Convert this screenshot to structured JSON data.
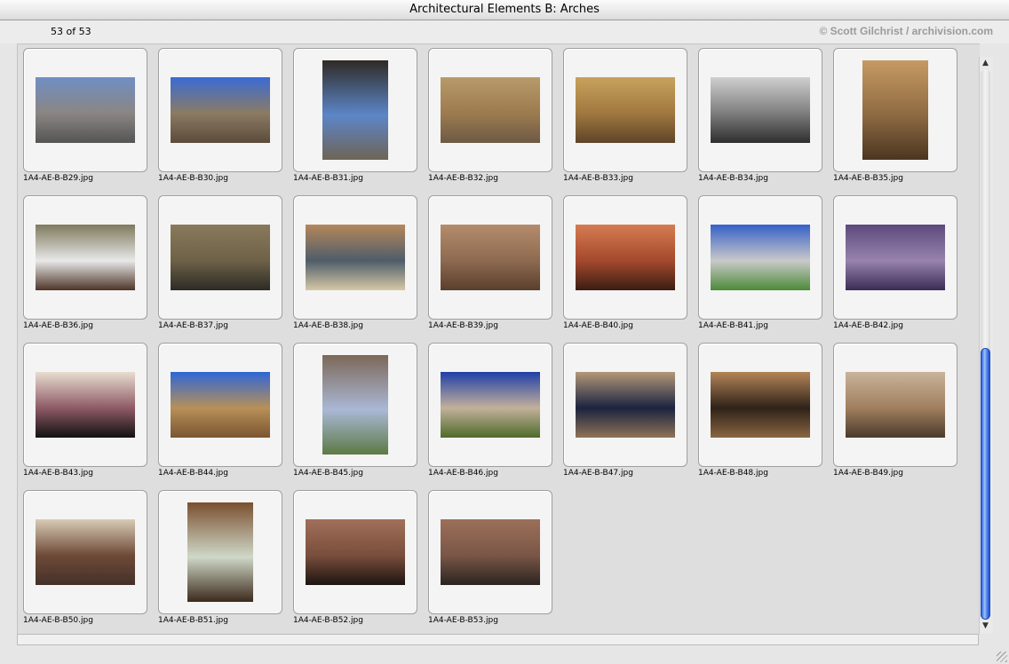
{
  "window": {
    "title": "Architectural Elements B: Arches"
  },
  "header": {
    "count": "53 of 53",
    "copyright": "© Scott Gilchrist / archivision.com"
  },
  "thumbnails": [
    {
      "file": "1A4-AE-B-B29.jpg",
      "orient": "land",
      "colors": [
        "#6f8fc4",
        "#8a8582",
        "#555"
      ]
    },
    {
      "file": "1A4-AE-B-B30.jpg",
      "orient": "land",
      "colors": [
        "#3a6bd4",
        "#8b7b63",
        "#5b4b3b"
      ]
    },
    {
      "file": "1A4-AE-B-B31.jpg",
      "orient": "port",
      "colors": [
        "#2f2a25",
        "#5c86c8",
        "#6e6456"
      ]
    },
    {
      "file": "1A4-AE-B-B32.jpg",
      "orient": "land",
      "colors": [
        "#b89a6a",
        "#9c7b4f",
        "#6d5a45"
      ]
    },
    {
      "file": "1A4-AE-B-B33.jpg",
      "orient": "land",
      "colors": [
        "#c7a25c",
        "#a07840",
        "#5e4428"
      ]
    },
    {
      "file": "1A4-AE-B-B34.jpg",
      "orient": "land",
      "colors": [
        "#cfcfcf",
        "#7d7d7d",
        "#2e2e2e"
      ]
    },
    {
      "file": "1A4-AE-B-B35.jpg",
      "orient": "port",
      "colors": [
        "#c69a63",
        "#8e6a42",
        "#4b3521"
      ]
    },
    {
      "file": "1A4-AE-B-B36.jpg",
      "orient": "land",
      "colors": [
        "#7f7a5e",
        "#e8e8e8",
        "#4e3528"
      ]
    },
    {
      "file": "1A4-AE-B-B37.jpg",
      "orient": "land",
      "colors": [
        "#8a7a5c",
        "#6d6148",
        "#2c2b25"
      ]
    },
    {
      "file": "1A4-AE-B-B38.jpg",
      "orient": "land",
      "colors": [
        "#b5875b",
        "#4e5d6a",
        "#d6c8a6"
      ]
    },
    {
      "file": "1A4-AE-B-B39.jpg",
      "orient": "land",
      "colors": [
        "#b48c6c",
        "#8d6a50",
        "#5a3e2d"
      ]
    },
    {
      "file": "1A4-AE-B-B40.jpg",
      "orient": "land",
      "colors": [
        "#d67c52",
        "#a4492d",
        "#3a1d12"
      ]
    },
    {
      "file": "1A4-AE-B-B41.jpg",
      "orient": "land",
      "colors": [
        "#3560c9",
        "#c9c9c9",
        "#4c8a38"
      ]
    },
    {
      "file": "1A4-AE-B-B42.jpg",
      "orient": "land",
      "colors": [
        "#5c4a7c",
        "#9883ad",
        "#3a2c55"
      ]
    },
    {
      "file": "1A4-AE-B-B43.jpg",
      "orient": "land",
      "colors": [
        "#e8ddd0",
        "#8e5a66",
        "#111"
      ]
    },
    {
      "file": "1A4-AE-B-B44.jpg",
      "orient": "land",
      "colors": [
        "#2e66d6",
        "#b89058",
        "#7a5530"
      ]
    },
    {
      "file": "1A4-AE-B-B45.jpg",
      "orient": "port",
      "colors": [
        "#7c6858",
        "#aab8d6",
        "#5c7a44"
      ]
    },
    {
      "file": "1A4-AE-B-B46.jpg",
      "orient": "land",
      "colors": [
        "#1f3fa8",
        "#c3b19a",
        "#4e6a2a"
      ]
    },
    {
      "file": "1A4-AE-B-B47.jpg",
      "orient": "land",
      "colors": [
        "#b49878",
        "#1b2340",
        "#8f7356"
      ]
    },
    {
      "file": "1A4-AE-B-B48.jpg",
      "orient": "land",
      "colors": [
        "#b48458",
        "#2e2218",
        "#8a6642"
      ]
    },
    {
      "file": "1A4-AE-B-B49.jpg",
      "orient": "land",
      "colors": [
        "#c8b49a",
        "#a17e5e",
        "#4a3a2c"
      ]
    },
    {
      "file": "1A4-AE-B-B50.jpg",
      "orient": "land",
      "colors": [
        "#d8cbb5",
        "#6e4a38",
        "#443028"
      ]
    },
    {
      "file": "1A4-AE-B-B51.jpg",
      "orient": "port",
      "colors": [
        "#7a5030",
        "#cfd8c8",
        "#3c2a1c"
      ]
    },
    {
      "file": "1A4-AE-B-B52.jpg",
      "orient": "land",
      "colors": [
        "#a0705a",
        "#7a4e3c",
        "#1c1410"
      ]
    },
    {
      "file": "1A4-AE-B-B53.jpg",
      "orient": "land",
      "colors": [
        "#9c705a",
        "#7a5646",
        "#2a2420"
      ]
    }
  ],
  "scrollbar": {
    "position": 0.72
  }
}
